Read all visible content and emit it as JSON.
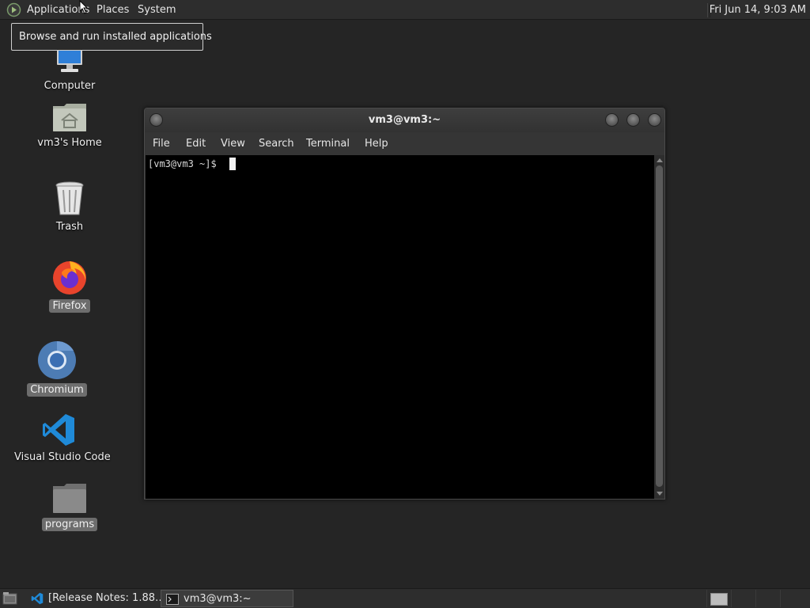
{
  "top_panel": {
    "menus": [
      "Applications",
      "Places",
      "System"
    ],
    "clock": "Fri Jun 14,  9:03 AM"
  },
  "tooltip": "Browse and run installed applications",
  "desktop_icons": [
    {
      "label": "Computer",
      "icon": "computer-icon"
    },
    {
      "label": "vm3's Home",
      "icon": "home-folder-icon"
    },
    {
      "label": "Trash",
      "icon": "trash-icon"
    },
    {
      "label": "Firefox",
      "icon": "firefox-icon"
    },
    {
      "label": "Chromium",
      "icon": "chromium-icon"
    },
    {
      "label": "Visual Studio Code",
      "icon": "vscode-icon"
    },
    {
      "label": "programs",
      "icon": "folder-icon"
    }
  ],
  "terminal": {
    "title": "vm3@vm3:~",
    "menus": [
      "File",
      "Edit",
      "View",
      "Search",
      "Terminal",
      "Help"
    ],
    "prompt": "[vm3@vm3 ~]$ "
  },
  "taskbar": {
    "tasks": [
      {
        "label": "[Release Notes: 1.88…",
        "icon": "vscode-icon",
        "active": false
      },
      {
        "label": "vm3@vm3:~",
        "icon": "terminal-icon",
        "active": true
      }
    ]
  },
  "colors": {
    "desktop_bg": "#252525",
    "panel_bg": "#2d2d2d",
    "selection_label": "#6d6d6d"
  }
}
